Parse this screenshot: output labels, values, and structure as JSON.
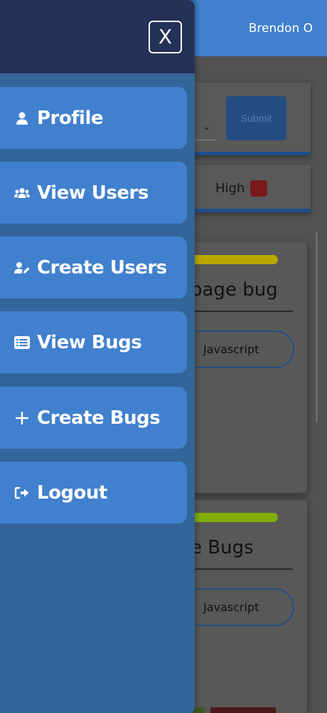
{
  "topbar": {
    "user_name": "Brendon O"
  },
  "filter": {
    "submit_label": "Submit",
    "chevron": "⌄"
  },
  "priority": {
    "label": "High",
    "swatch_color": "#7a1a1a"
  },
  "bugs": [
    {
      "title": "page bug",
      "language": "Javascript",
      "status_color": "#b9a800"
    },
    {
      "title": "e Bugs",
      "language": "Javascript",
      "status_color": "#7fae00"
    }
  ],
  "drawer": {
    "close_label": "X",
    "items": [
      {
        "label": "Profile",
        "icon": "user-icon"
      },
      {
        "label": "View Users",
        "icon": "users-icon"
      },
      {
        "label": "Create Users",
        "icon": "user-edit-icon"
      },
      {
        "label": "View Bugs",
        "icon": "list-icon"
      },
      {
        "label": "Create Bugs",
        "icon": "plus-icon"
      },
      {
        "label": "Logout",
        "icon": "logout-icon"
      }
    ]
  },
  "colors": {
    "accent": "#4080ce",
    "drawer_bg": "#33659a",
    "drawer_header": "#253257"
  }
}
